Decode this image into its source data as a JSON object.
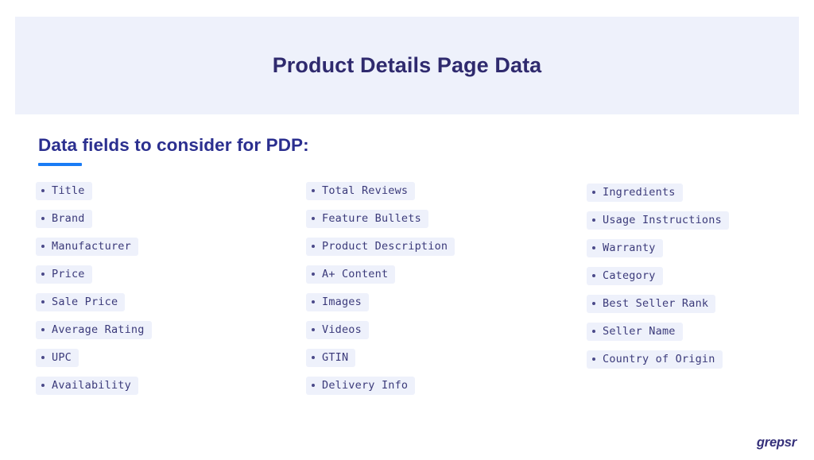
{
  "banner": {
    "title": "Product Details Page Data",
    "background_color": "#eef1fb",
    "title_color": "#2f2a6e"
  },
  "section": {
    "heading": "Data fields to consider for PDP:",
    "heading_color": "#2b2f8f",
    "accent_color": "#1a7cf5"
  },
  "columns": [
    {
      "items": [
        {
          "label": "Title"
        },
        {
          "label": "Brand"
        },
        {
          "label": "Manufacturer"
        },
        {
          "label": "Price"
        },
        {
          "label": "Sale Price"
        },
        {
          "label": "Average Rating"
        },
        {
          "label": "UPC"
        },
        {
          "label": "Availability"
        }
      ]
    },
    {
      "items": [
        {
          "label": "Total Reviews"
        },
        {
          "label": "Feature Bullets"
        },
        {
          "label": "Product Description"
        },
        {
          "label": "A+ Content"
        },
        {
          "label": "Images"
        },
        {
          "label": "Videos"
        },
        {
          "label": "GTIN"
        },
        {
          "label": "Delivery Info"
        }
      ]
    },
    {
      "items": [
        {
          "label": "Ingredients"
        },
        {
          "label": "Usage Instructions"
        },
        {
          "label": "Warranty"
        },
        {
          "label": "Category"
        },
        {
          "label": "Best Seller Rank"
        },
        {
          "label": "Seller Name"
        },
        {
          "label": "Country of Origin"
        }
      ]
    }
  ],
  "footer": {
    "logo_text": "grepsr",
    "logo_color": "#35307a"
  },
  "page": {
    "background_color": "#ffffff",
    "pill_background": "#eef1fb",
    "pill_text_color": "#3b3a7a"
  }
}
